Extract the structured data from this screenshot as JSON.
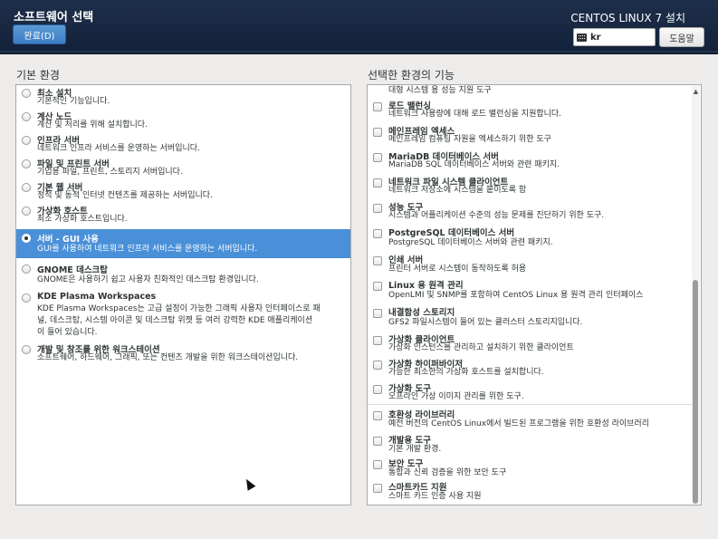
{
  "header": {
    "title": "소프트웨어 선택",
    "done_label": "완료(D)",
    "os_title": "CENTOS LINUX 7 설치",
    "keyboard": "kr",
    "help_label": "도움말"
  },
  "left": {
    "label": "기본 환경",
    "items": [
      {
        "name": "최소 설치",
        "desc": "기본적인 기능입니다."
      },
      {
        "name": "계산 노드",
        "desc": "계산 및 처리를 위해 설치합니다."
      },
      {
        "name": "인프라 서버",
        "desc": "네트워크 인프라 서비스를 운영하는 서버입니다."
      },
      {
        "name": "파일 및 프린트 서버",
        "desc": "기업용 파일, 프린트, 스토리지 서버입니다."
      },
      {
        "name": "기본 웹 서버",
        "desc": "정적 및 동적 인터넷 컨텐츠를 제공하는 서버입니다."
      },
      {
        "name": "가상화 호스트",
        "desc": "최소 가상화 호스트입니다."
      },
      {
        "name": "서버 - GUI 사용",
        "desc": "GUI를 사용하여 네트워크 인프라 서비스를 운영하는 서버입니다."
      },
      {
        "name": "GNOME 데스크탑",
        "desc": "GNOME은 사용하기 쉽고 사용자 친화적인 데스크탑 환경입니다."
      },
      {
        "name": "KDE Plasma Workspaces",
        "desc1": "KDE Plasma Workspaces는 고급 설정이 가능한 그래픽 사용자 인터페이스로 패",
        "desc2": "널, 데스크탑, 시스템 아이콘 및 데스크탑 위젯 등 여러 강력한 KDE 애플리케이션",
        "desc3": "이 들어 있습니다."
      },
      {
        "name": "개발 및 창조를 위한 워크스테이션",
        "desc": "소프트웨어, 하드웨어, 그래픽, 또는 컨텐츠 개발을 위한 워크스테이션입니다."
      }
    ]
  },
  "right": {
    "label": "선택한 환경의 기능",
    "partial_top": "대형 시스템 용 성능 지원 도구",
    "items": [
      {
        "name": "로드 밸런싱",
        "desc": "네트워크 사용량에 대해 로드 밸런싱을 지원합니다."
      },
      {
        "name": "메인프레임 엑세스",
        "desc": "메인프레임 컴퓨팅 자원을 엑세스하기 위한 도구"
      },
      {
        "name": "MariaDB 데이터베이스 서버",
        "desc": "MariaDB SQL 데이터베이스 서버와 관련 패키지."
      },
      {
        "name": "네트워크 파일 시스템 클라이언트",
        "desc": "네트워크 저장소에 시스템을 붙이도록 함"
      },
      {
        "name": "성능 도구",
        "desc": "시스템과 어플리케이션 수준의 성능 문제를 진단하기 위한 도구."
      },
      {
        "name": "PostgreSQL 데이터베이스 서버",
        "desc": "PostgreSQL 데이터베이스 서버와 관련 패키지."
      },
      {
        "name": "인쇄 서버",
        "desc": "프린터 서버로 시스템이 동작하도록 허용"
      },
      {
        "name": "Linux 용 원격 관리",
        "desc": "OpenLMI 및 SNMP를 포함하여 CentOS Linux 용 원격 관리 인터페이스"
      },
      {
        "name": "내결함성 스토리지",
        "desc": "GFS2 파일시스템이 들어 있는 클러스터 스토리지입니다."
      },
      {
        "name": "가상화 클라이언트",
        "desc": "가상화 인스턴스를 관리하고 설치하기 위한 클라이언트"
      },
      {
        "name": "가상화 하이퍼바이저",
        "desc": "가능한 최소한의 가상화 호스트를 설치합니다."
      },
      {
        "name": "가상화 도구",
        "desc": "오프라인 가상 이미지 관리를 위한 도구."
      },
      {
        "name": "호환성 라이브러리",
        "desc": "예전 버전의 CentOS Linux에서 빌드된 프로그램을 위한 호환성 라이브러리"
      },
      {
        "name": "개발용 도구",
        "desc": "기본 개발 환경."
      },
      {
        "name": "보안 도구",
        "desc": "통합과 신뢰 검증을 위한 보안 도구"
      },
      {
        "name": "스마트카드 지원",
        "desc": "스마트 카드 인증 사용 지원"
      }
    ]
  }
}
